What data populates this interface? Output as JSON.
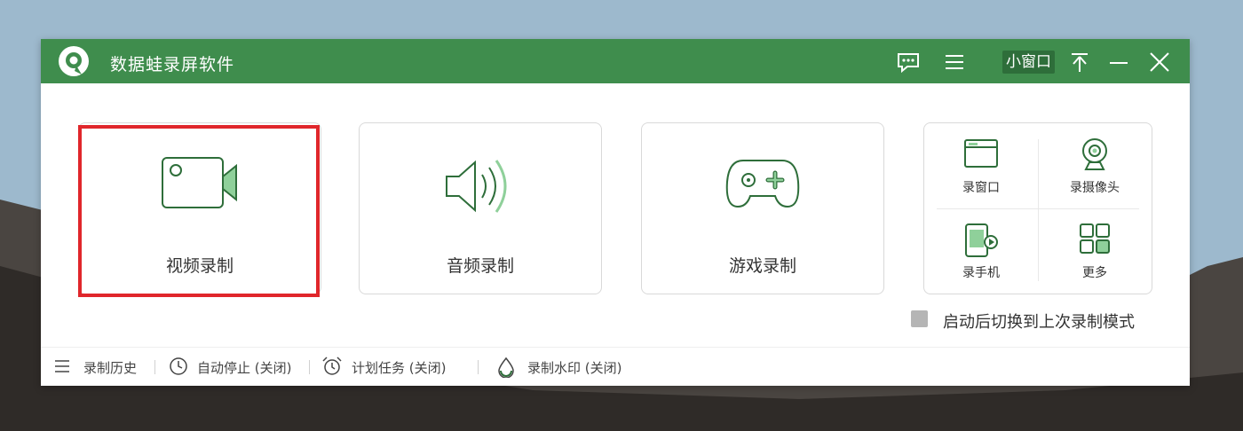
{
  "window": {
    "title": "数据蛙录屏软件",
    "mini_window_label": "小窗口",
    "accent_color": "#3f8d4d",
    "highlight_color": "#e0262b"
  },
  "titlebar_icons": [
    "feedback-icon",
    "menu-icon",
    "pin-icon",
    "minimize-icon",
    "close-icon"
  ],
  "main_cards": [
    {
      "label": "视频录制",
      "icon": "video-camera-icon",
      "highlighted": true
    },
    {
      "label": "音频录制",
      "icon": "speaker-icon",
      "highlighted": false
    },
    {
      "label": "游戏录制",
      "icon": "gamepad-icon",
      "highlighted": false
    }
  ],
  "grid_card": {
    "items": [
      {
        "label": "录窗口",
        "icon": "window-icon"
      },
      {
        "label": "录摄像头",
        "icon": "webcam-icon"
      },
      {
        "label": "录手机",
        "icon": "phone-icon"
      },
      {
        "label": "更多",
        "icon": "grid-more-icon"
      }
    ]
  },
  "remember_mode": {
    "label": "启动后切换到上次录制模式",
    "checked": false
  },
  "statusbar": {
    "history": "录制历史",
    "auto_stop": "自动停止 (关闭)",
    "schedule": "计划任务 (关闭)",
    "watermark": "录制水印 (关闭)"
  }
}
